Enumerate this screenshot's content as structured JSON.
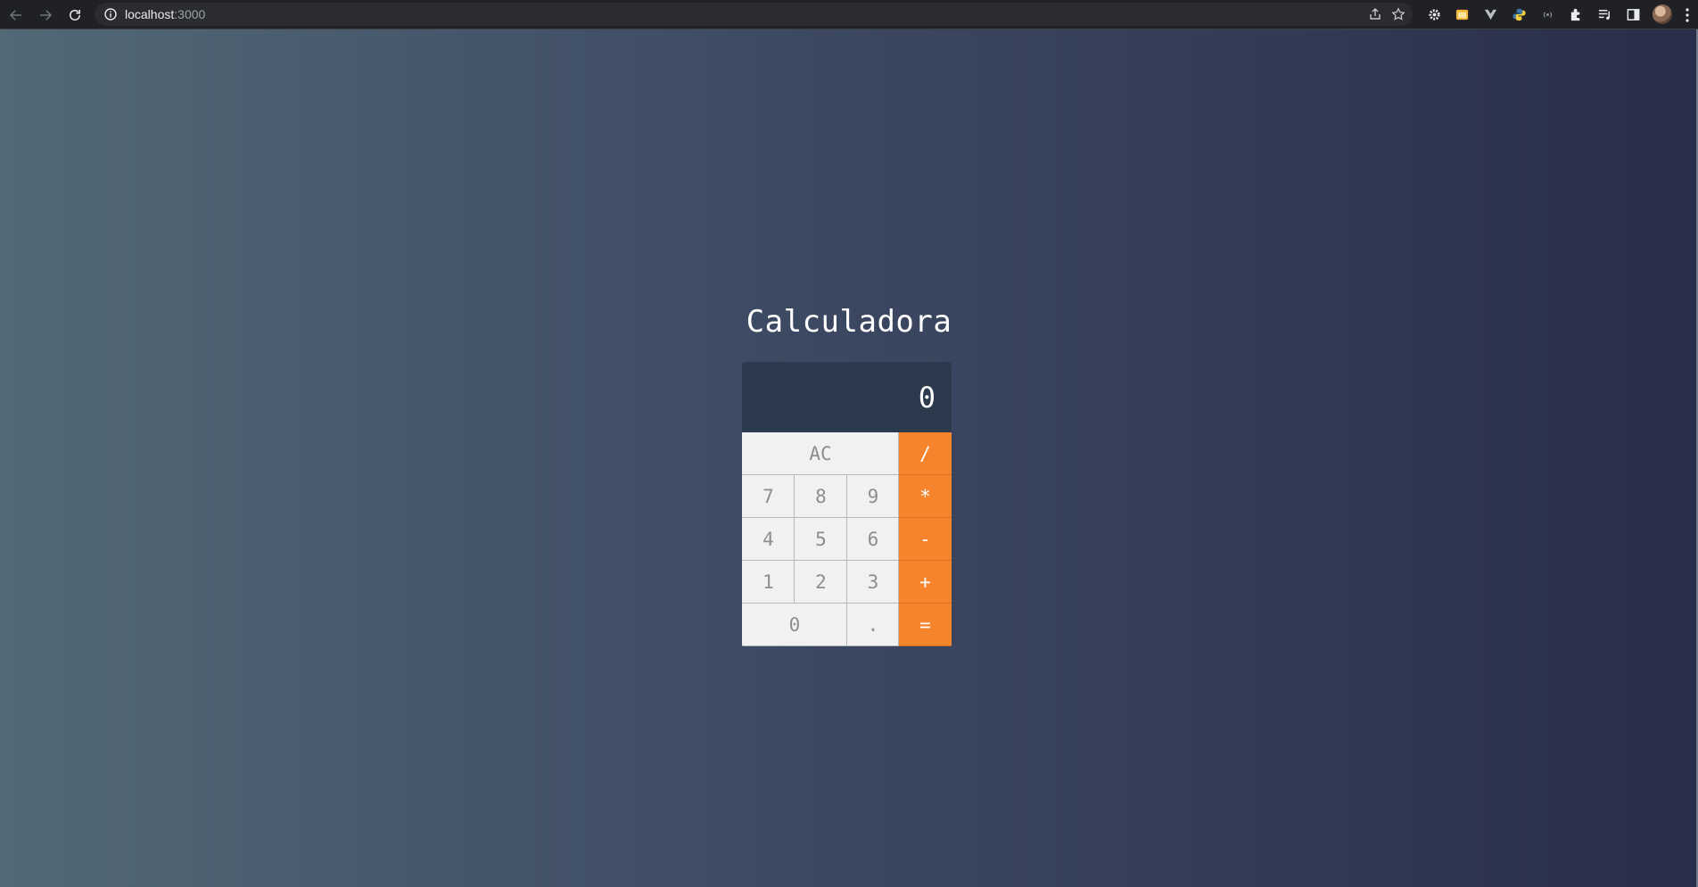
{
  "browser": {
    "url_host": "localhost",
    "url_port": ":3000",
    "icons": {
      "back": "back-arrow-icon",
      "forward": "forward-arrow-icon",
      "reload": "reload-icon",
      "info": "info-icon",
      "share": "share-icon",
      "bookmark": "star-icon",
      "extensions": [
        "gear-extension-icon",
        "folder-extension-icon",
        "vue-extension-icon",
        "python-extension-icon",
        "radio-extension-icon",
        "puzzle-extensions-icon",
        "playlist-icon",
        "side-panel-icon"
      ],
      "profile": "avatar",
      "menu": "kebab-menu-icon"
    }
  },
  "page": {
    "title": "Calculadora",
    "background_gradient": [
      "#536976",
      "#292e4a"
    ]
  },
  "calculator": {
    "display": "0",
    "accent_color": "#f6842c",
    "key_color": "#f1f1f1",
    "display_color": "#2c3a4e",
    "keys": {
      "clear": "AC",
      "divide": "/",
      "seven": "7",
      "eight": "8",
      "nine": "9",
      "multiply": "*",
      "four": "4",
      "five": "5",
      "six": "6",
      "subtract": "-",
      "one": "1",
      "two": "2",
      "three": "3",
      "add": "+",
      "zero": "0",
      "decimal": ".",
      "equals": "="
    }
  }
}
